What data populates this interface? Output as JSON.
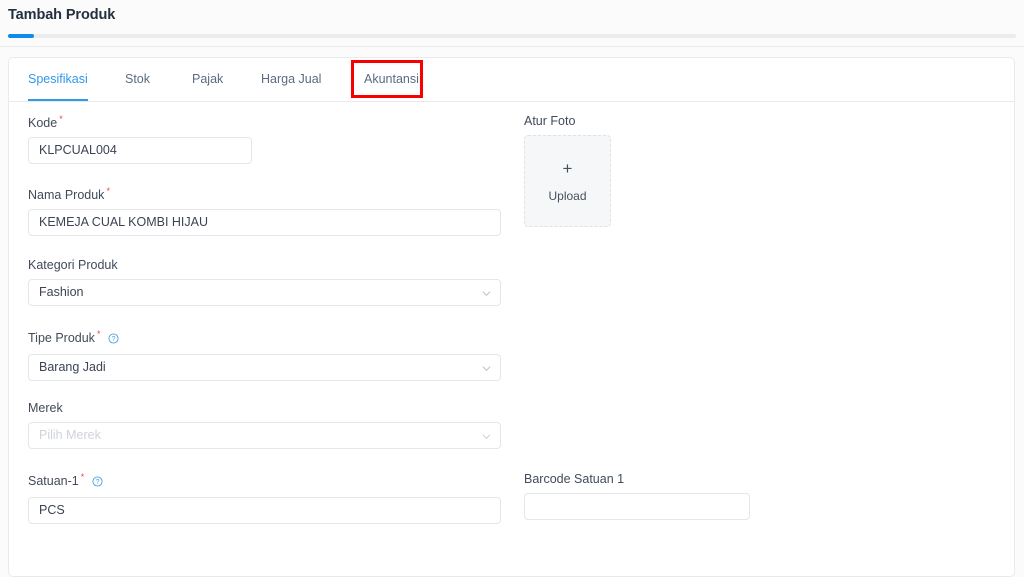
{
  "header": {
    "title": "Tambah Produk",
    "progress_percent": 2.6
  },
  "tabs": [
    {
      "label": "Spesifikasi",
      "active": true
    },
    {
      "label": "Stok",
      "active": false
    },
    {
      "label": "Pajak",
      "active": false
    },
    {
      "label": "Harga Jual",
      "active": false
    },
    {
      "label": "Akuntansi",
      "active": false,
      "highlighted": true
    }
  ],
  "colors": {
    "accent": "#2f9ae8",
    "progress": "#0f8ce9",
    "required": "#ef4444",
    "highlight_box": "#f80000",
    "label": "#414b5a",
    "input_border": "#e4e6e9",
    "placeholder": "#cfd3d8"
  },
  "form": {
    "kode": {
      "label": "Kode",
      "required": "*",
      "value": "KLPCUAL004"
    },
    "nama_produk": {
      "label": "Nama Produk",
      "required": "*",
      "value": "KEMEJA CUAL KOMBI HIJAU"
    },
    "kategori_produk": {
      "label": "Kategori Produk",
      "value": "Fashion"
    },
    "tipe_produk": {
      "label": "Tipe Produk",
      "required": "*",
      "value": "Barang Jadi",
      "has_help": true
    },
    "merek": {
      "label": "Merek",
      "placeholder": "Pilih Merek",
      "value": ""
    },
    "satuan_1": {
      "label": "Satuan-1",
      "required": "*",
      "value": "PCS",
      "has_help": true
    },
    "atur_foto": {
      "label": "Atur Foto",
      "upload_label": "Upload",
      "plus_glyph": "+"
    },
    "barcode_satuan_1": {
      "label": "Barcode Satuan 1",
      "value": ""
    }
  }
}
